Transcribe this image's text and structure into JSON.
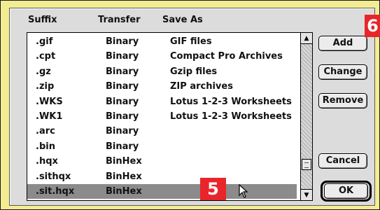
{
  "columns": {
    "suffix": "Suffix",
    "transfer": "Transfer",
    "save_as": "Save As"
  },
  "rows": [
    {
      "suffix": ".gif",
      "transfer": "Binary",
      "save_as": "GIF files"
    },
    {
      "suffix": ".cpt",
      "transfer": "Binary",
      "save_as": "Compact Pro Archives"
    },
    {
      "suffix": ".gz",
      "transfer": "Binary",
      "save_as": "Gzip files"
    },
    {
      "suffix": ".zip",
      "transfer": "Binary",
      "save_as": "ZIP archives"
    },
    {
      "suffix": ".WKS",
      "transfer": "Binary",
      "save_as": "Lotus 1-2-3 Worksheets"
    },
    {
      "suffix": ".WK1",
      "transfer": "Binary",
      "save_as": "Lotus 1-2-3 Worksheets"
    },
    {
      "suffix": ".arc",
      "transfer": "Binary",
      "save_as": ""
    },
    {
      "suffix": ".bin",
      "transfer": "Binary",
      "save_as": ""
    },
    {
      "suffix": ".hqx",
      "transfer": "BinHex",
      "save_as": ""
    },
    {
      "suffix": ".sithqx",
      "transfer": "BinHex",
      "save_as": ""
    },
    {
      "suffix": ".sit.hqx",
      "transfer": "BinHex",
      "save_as": ""
    }
  ],
  "selected_row_index": 10,
  "buttons": {
    "add": "Add",
    "change": "Change",
    "remove": "Remove",
    "cancel": "Cancel",
    "ok": "OK"
  },
  "annotations": {
    "badge_5": "5",
    "badge_6": "6"
  },
  "icons": {
    "scroll_up": "up-arrow-icon",
    "scroll_down": "down-arrow-icon",
    "pointer": "arrow-cursor-icon"
  },
  "colors": {
    "frame_background": "#f2ed92",
    "dialog_background": "#dcdcdc",
    "selected_row": "#8b8b8b",
    "badge": "#e8252b"
  }
}
